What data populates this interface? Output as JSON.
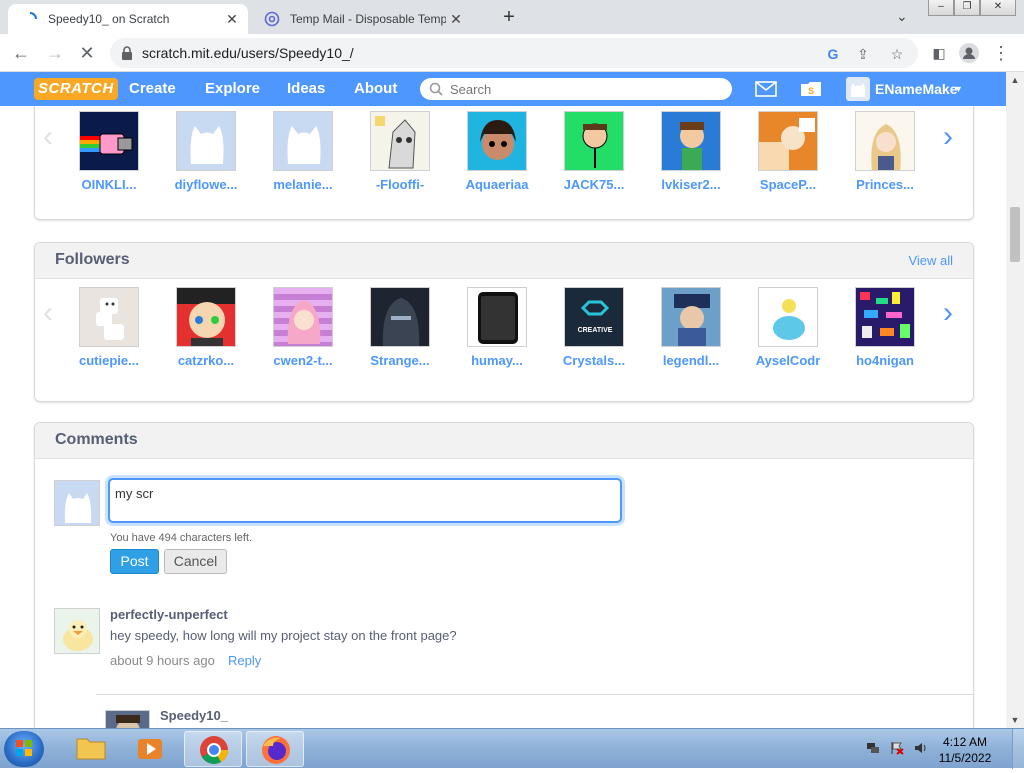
{
  "browser": {
    "tabs": [
      {
        "title": "Speedy10_ on Scratch",
        "active": true
      },
      {
        "title": "Temp Mail - Disposable Tempora",
        "active": false
      }
    ],
    "url": "scratch.mit.edu/users/Speedy10_/"
  },
  "scratch_header": {
    "logo_text": "SCRATCH",
    "nav": [
      "Create",
      "Explore",
      "Ideas",
      "About"
    ],
    "search_placeholder": "Search",
    "username": "ENameMake"
  },
  "following": {
    "items": [
      {
        "label": "OINKLI..."
      },
      {
        "label": "diyflowe..."
      },
      {
        "label": "melanie..."
      },
      {
        "label": "-Flooffi-"
      },
      {
        "label": "Aquaeriaa"
      },
      {
        "label": "JACK75..."
      },
      {
        "label": "lvkiser2..."
      },
      {
        "label": "SpaceP..."
      },
      {
        "label": "Princes..."
      }
    ]
  },
  "followers": {
    "title": "Followers",
    "view_all": "View all",
    "items": [
      {
        "label": "cutiepie..."
      },
      {
        "label": "catzrko..."
      },
      {
        "label": "cwen2-t..."
      },
      {
        "label": "Strange..."
      },
      {
        "label": "humay..."
      },
      {
        "label": "Crystals..."
      },
      {
        "label": "legendl..."
      },
      {
        "label": "AyselCodr"
      },
      {
        "label": "ho4nigan"
      }
    ],
    "crystals_badge": "CREATIVE"
  },
  "comments": {
    "title": "Comments",
    "input_value": "my scr",
    "chars_left": "You have 494 characters left.",
    "post_label": "Post",
    "cancel_label": "Cancel",
    "list": [
      {
        "user": "perfectly-unperfect",
        "text": "hey speedy, how long will my project stay on the front page?",
        "time": "about 9 hours ago",
        "reply_label": "Reply"
      },
      {
        "user": "Speedy10_"
      }
    ]
  },
  "taskbar": {
    "time": "4:12 AM",
    "date": "11/5/2022"
  }
}
